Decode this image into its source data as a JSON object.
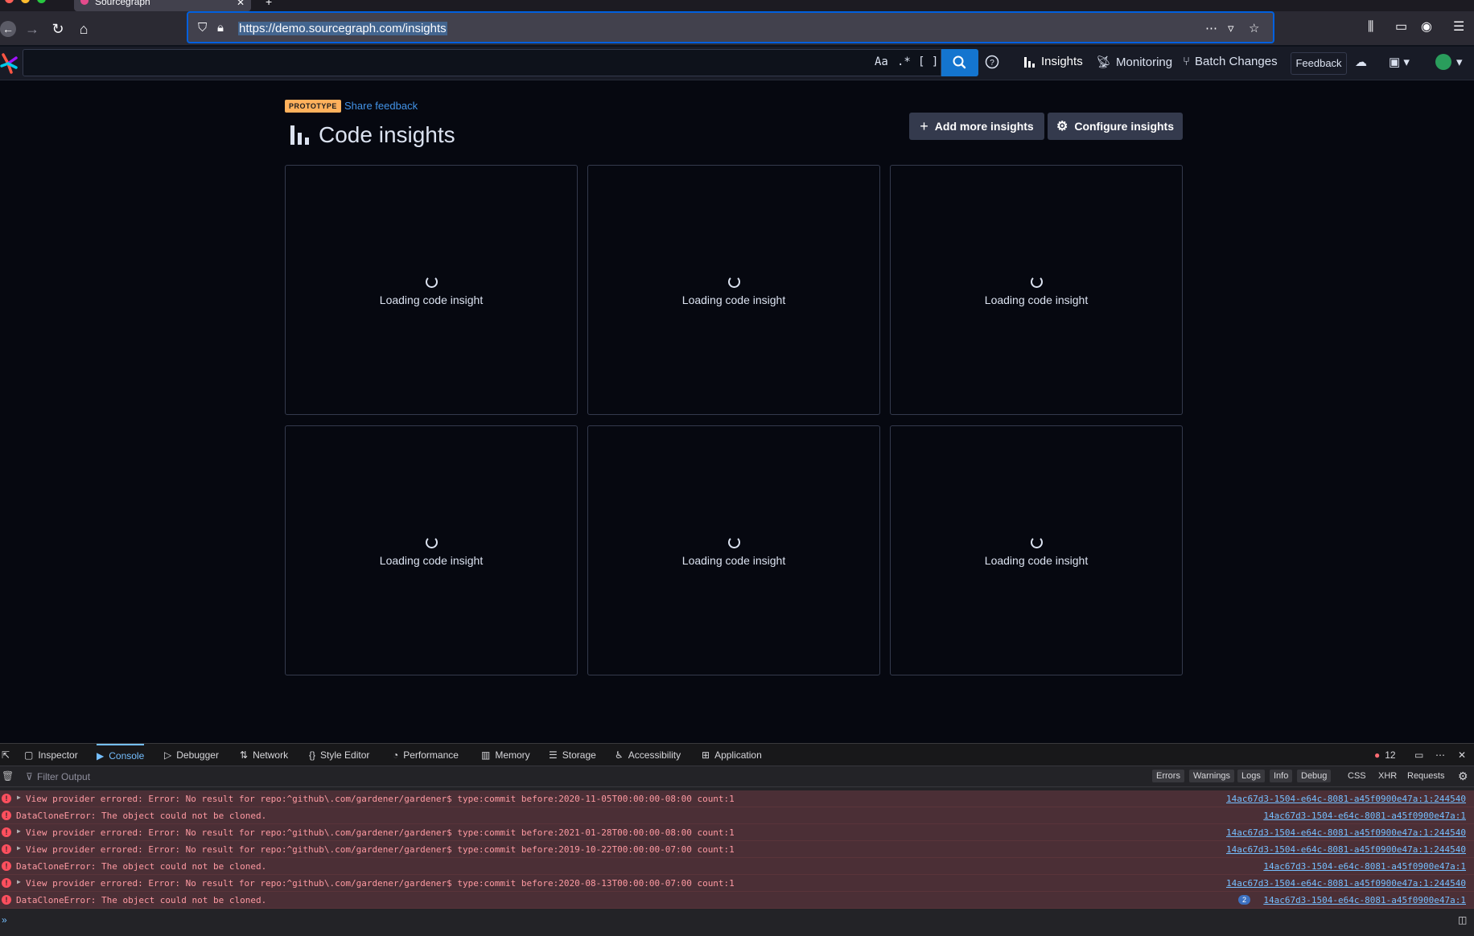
{
  "browser": {
    "tab_title": "Sourcegraph",
    "url": "https://demo.sourcegraph.com/insights"
  },
  "app_nav": {
    "search_toggles": [
      "Aa",
      ".*",
      "[ ]"
    ],
    "items": [
      {
        "label": "Insights",
        "active": true
      },
      {
        "label": "Monitoring",
        "active": false
      },
      {
        "label": "Batch Changes",
        "active": false
      }
    ],
    "feedback_label": "Feedback"
  },
  "page": {
    "badge": "PROTOTYPE",
    "share_feedback": "Share feedback",
    "title": "Code insights",
    "add_button": "Add more insights",
    "configure_button": "Configure insights",
    "cards": [
      {
        "label": "Loading code insight"
      },
      {
        "label": "Loading code insight"
      },
      {
        "label": "Loading code insight"
      },
      {
        "label": "Loading code insight"
      },
      {
        "label": "Loading code insight"
      },
      {
        "label": "Loading code insight"
      }
    ]
  },
  "devtools": {
    "tabs": [
      "Inspector",
      "Console",
      "Debugger",
      "Network",
      "Style Editor",
      "Performance",
      "Memory",
      "Storage",
      "Accessibility",
      "Application"
    ],
    "active_tab": "Console",
    "error_count": "12",
    "filter_placeholder": "Filter Output",
    "filters": [
      "Errors",
      "Warnings",
      "Logs",
      "Info",
      "Debug",
      "CSS",
      "XHR",
      "Requests"
    ],
    "messages": [
      {
        "text": "View provider errored: Error: No result for repo:^github\\.com/gardener/gardener$ type:commit before:2020-11-05T00:00:00-08:00 count:1",
        "source": "14ac67d3-1504-e64c-8081-a45f0900e47a:1:244540",
        "expandable": true
      },
      {
        "text": "DataCloneError: The object could not be cloned.",
        "source": "14ac67d3-1504-e64c-8081-a45f0900e47a:1",
        "expandable": false
      },
      {
        "text": "View provider errored: Error: No result for repo:^github\\.com/gardener/gardener$ type:commit before:2021-01-28T00:00:00-08:00 count:1",
        "source": "14ac67d3-1504-e64c-8081-a45f0900e47a:1:244540",
        "expandable": true
      },
      {
        "text": "View provider errored: Error: No result for repo:^github\\.com/gardener/gardener$ type:commit before:2019-10-22T00:00:00-07:00 count:1",
        "source": "14ac67d3-1504-e64c-8081-a45f0900e47a:1:244540",
        "expandable": true
      },
      {
        "text": "DataCloneError: The object could not be cloned.",
        "source": "14ac67d3-1504-e64c-8081-a45f0900e47a:1",
        "expandable": false
      },
      {
        "text": "View provider errored: Error: No result for repo:^github\\.com/gardener/gardener$ type:commit before:2020-08-13T00:00:00-07:00 count:1",
        "source": "14ac67d3-1504-e64c-8081-a45f0900e47a:1:244540",
        "expandable": true
      },
      {
        "text": "DataCloneError: The object could not be cloned.",
        "source": "14ac67d3-1504-e64c-8081-a45f0900e47a:1",
        "expandable": false,
        "repeat": "2"
      }
    ]
  }
}
